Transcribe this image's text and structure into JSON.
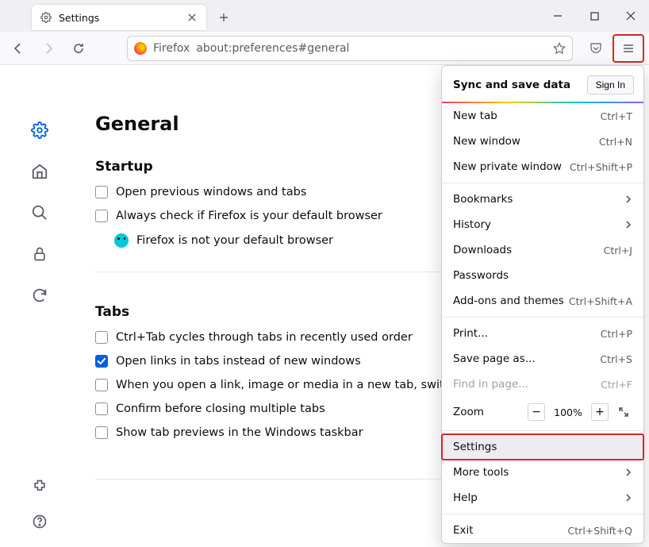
{
  "window": {
    "tab_title": "Settings"
  },
  "toolbar": {
    "identity_label": "Firefox",
    "url": "about:preferences#general"
  },
  "settings": {
    "page_title": "General",
    "startup": {
      "heading": "Startup",
      "open_previous": "Open previous windows and tabs",
      "always_check": "Always check if Firefox is your default browser",
      "not_default": "Firefox is not your default browser"
    },
    "tabs": {
      "heading": "Tabs",
      "ctrl_tab": "Ctrl+Tab cycles through tabs in recently used order",
      "open_links": "Open links in tabs instead of new windows",
      "switch_to": "When you open a link, image or media in a new tab, switch t",
      "confirm_close": "Confirm before closing multiple tabs",
      "show_previews": "Show tab previews in the Windows taskbar"
    }
  },
  "menu": {
    "sync_label": "Sync and save data",
    "sign_in": "Sign In",
    "new_tab": {
      "label": "New tab",
      "key": "Ctrl+T"
    },
    "new_window": {
      "label": "New window",
      "key": "Ctrl+N"
    },
    "new_private": {
      "label": "New private window",
      "key": "Ctrl+Shift+P"
    },
    "bookmarks": {
      "label": "Bookmarks"
    },
    "history": {
      "label": "History"
    },
    "downloads": {
      "label": "Downloads",
      "key": "Ctrl+J"
    },
    "passwords": {
      "label": "Passwords"
    },
    "addons": {
      "label": "Add-ons and themes",
      "key": "Ctrl+Shift+A"
    },
    "print": {
      "label": "Print...",
      "key": "Ctrl+P"
    },
    "save_as": {
      "label": "Save page as...",
      "key": "Ctrl+S"
    },
    "find": {
      "label": "Find in page...",
      "key": "Ctrl+F"
    },
    "zoom": {
      "label": "Zoom",
      "value": "100%"
    },
    "settings": {
      "label": "Settings"
    },
    "more_tools": {
      "label": "More tools"
    },
    "help": {
      "label": "Help"
    },
    "exit": {
      "label": "Exit",
      "key": "Ctrl+Shift+Q"
    }
  }
}
